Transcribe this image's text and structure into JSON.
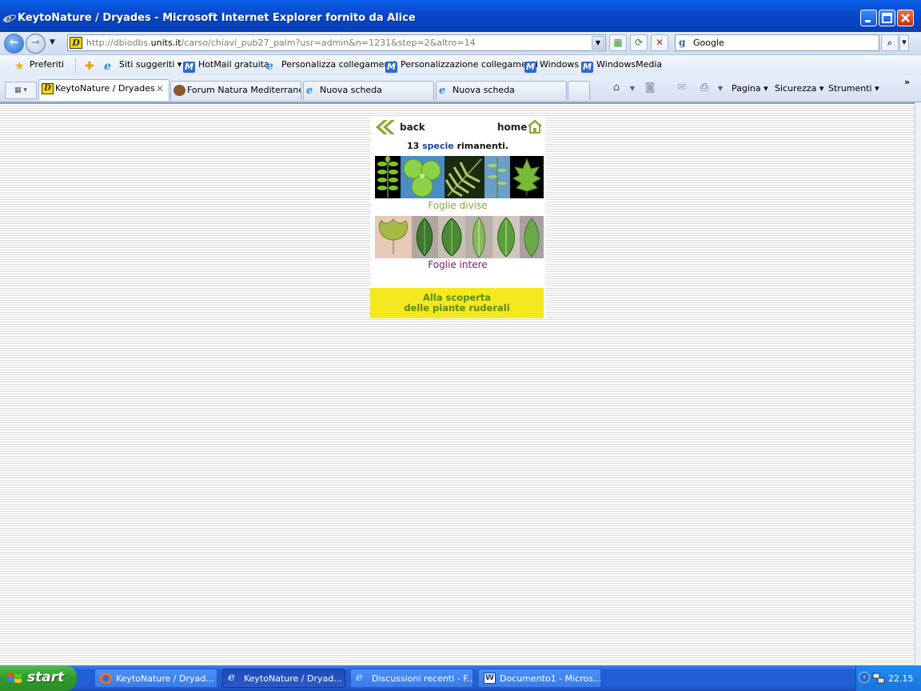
{
  "window": {
    "title": "KeytoNature / Dryades - Microsoft Internet Explorer fornito da Alice"
  },
  "address_bar": {
    "url_prefix": "http://dbiodbs.",
    "url_domain": "units.it",
    "url_rest": "/carso/chiavi_pub27_palm?usr=admin&n=1231&step=2&altro=14"
  },
  "search": {
    "engine_letter": "g",
    "value": "Google"
  },
  "favorites_bar": {
    "items": [
      {
        "label": "Preferiti",
        "icon": "star-icon"
      },
      {
        "label": "Siti suggeriti ▾",
        "icon": "ie-icon"
      },
      {
        "label": "HotMail gratuita",
        "icon": "msn-icon"
      },
      {
        "label": "Personalizza collegamenti",
        "icon": "ie-icon"
      },
      {
        "label": "Personalizzazione collegamenti",
        "icon": "msn-icon"
      },
      {
        "label": "Windows",
        "icon": "msn-icon"
      },
      {
        "label": "WindowsMedia",
        "icon": "msn-icon"
      }
    ]
  },
  "tabs": [
    {
      "label": "KeytoNature / Dryades",
      "active": true
    },
    {
      "label": "Forum Natura Mediterrane...",
      "active": false
    },
    {
      "label": "Nuova scheda",
      "active": false
    },
    {
      "label": "Nuova scheda",
      "active": false
    }
  ],
  "command_bar": {
    "pagina": "Pagina ▾",
    "sicurezza": "Sicurezza ▾",
    "strumenti": "Strumenti ▾",
    "more": "»"
  },
  "page": {
    "back": "back",
    "home": "home",
    "count_number": "13",
    "count_word": "specie",
    "count_rest": "rimanenti.",
    "option1": "Foglie divise",
    "option2": "Foglie intere",
    "promo_line1": "Alla scoperta",
    "promo_line2": "delle piante ruderali",
    "colors": {
      "green": "#8aa83a",
      "purple": "#7b1a76",
      "promo_bg": "#f5e81e"
    }
  },
  "taskbar": {
    "start": "start",
    "buttons": [
      {
        "label": "KeytoNature / Dryad...",
        "icon": "firefox-icon",
        "active": false
      },
      {
        "label": "KeytoNature / Dryad...",
        "icon": "ie-icon",
        "active": true
      },
      {
        "label": "Discussioni recenti - F...",
        "icon": "ie-icon",
        "active": false
      },
      {
        "label": "Documento1 - Micros...",
        "icon": "word-icon",
        "active": false
      }
    ],
    "clock": "22.15"
  }
}
